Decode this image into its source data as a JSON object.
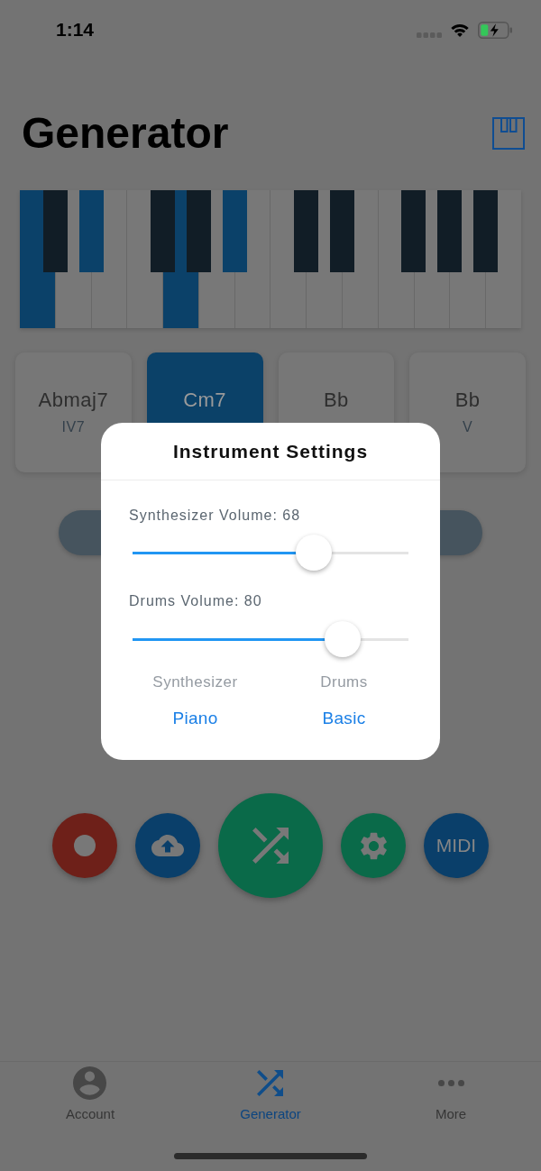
{
  "status_bar": {
    "time": "1:14"
  },
  "header": {
    "title": "Generator"
  },
  "piano": {
    "white_keys": [
      {
        "highlighted": true
      },
      {
        "highlighted": false
      },
      {
        "highlighted": false
      },
      {
        "highlighted": false
      },
      {
        "highlighted": true
      },
      {
        "highlighted": false
      },
      {
        "highlighted": false
      },
      {
        "highlighted": false
      },
      {
        "highlighted": false
      },
      {
        "highlighted": false
      },
      {
        "highlighted": false
      },
      {
        "highlighted": false
      },
      {
        "highlighted": false
      },
      {
        "highlighted": false
      }
    ],
    "black_keys": [
      {
        "highlighted": false
      },
      {
        "highlighted": true
      },
      {
        "highlighted": false
      },
      {
        "highlighted": false
      },
      {
        "highlighted": true
      },
      {
        "highlighted": false
      },
      {
        "highlighted": false
      },
      {
        "highlighted": false
      },
      {
        "highlighted": false
      },
      {
        "highlighted": false
      }
    ]
  },
  "chords": [
    {
      "name": "Abmaj7",
      "numeral": "IV7",
      "selected": false
    },
    {
      "name": "Cm7",
      "selected": true
    },
    {
      "name": "Bb",
      "selected": false
    },
    {
      "name": "Bb",
      "numeral": "V",
      "selected": false
    }
  ],
  "actions": [
    {
      "kind": "record"
    },
    {
      "kind": "upload"
    },
    {
      "kind": "shuffle"
    },
    {
      "kind": "settings"
    },
    {
      "kind": "midi",
      "label": "MIDI"
    }
  ],
  "dialog": {
    "title": "Instrument Settings",
    "sliders": [
      {
        "label": "Synthesizer Volume: 68",
        "level": 0.68
      },
      {
        "label": "Drums Volume: 80",
        "level": 0.8
      }
    ],
    "pickers": [
      {
        "label": "Synthesizer",
        "value": "Piano"
      },
      {
        "label": "Drums",
        "value": "Basic"
      }
    ]
  },
  "tab_bar": [
    {
      "kind": "account",
      "label": "Account",
      "selected": false
    },
    {
      "kind": "generator",
      "label": "Generator",
      "selected": true
    },
    {
      "kind": "more",
      "label": "More",
      "selected": false
    }
  ]
}
